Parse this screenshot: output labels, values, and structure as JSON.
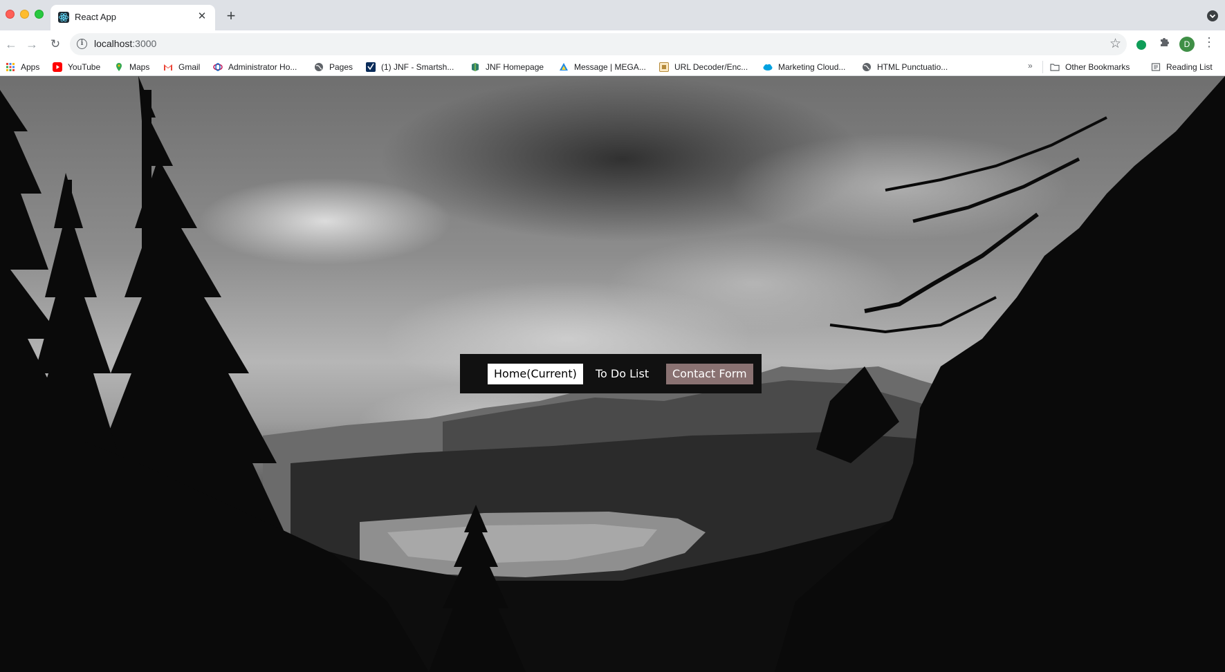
{
  "window": {
    "tab_title": "React App",
    "new_tab_symbol": "+"
  },
  "toolbar": {
    "url_host": "localhost",
    "url_port": ":3000",
    "profile_initial": "D"
  },
  "bookmarks": {
    "items": [
      {
        "label": "Apps",
        "icon": "apps-grid-icon"
      },
      {
        "label": "YouTube",
        "icon": "youtube-icon"
      },
      {
        "label": "Maps",
        "icon": "maps-pin-icon"
      },
      {
        "label": "Gmail",
        "icon": "gmail-icon"
      },
      {
        "label": "Administrator Ho...",
        "icon": "admin-icon"
      },
      {
        "label": "Pages",
        "icon": "globe-icon"
      },
      {
        "label": "(1) JNF - Smartsh...",
        "icon": "smartsheet-icon"
      },
      {
        "label": "JNF Homepage",
        "icon": "jnf-icon"
      },
      {
        "label": "Message | MEGA...",
        "icon": "mega-icon"
      },
      {
        "label": "URL Decoder/Enc...",
        "icon": "decoder-icon"
      },
      {
        "label": "Marketing Cloud...",
        "icon": "salesforce-cloud-icon"
      },
      {
        "label": "HTML Punctuatio...",
        "icon": "globe-icon"
      }
    ],
    "overflow": "»",
    "other_bookmarks": "Other Bookmarks",
    "reading_list": "Reading List"
  },
  "app": {
    "nav": {
      "home": "Home(Current)",
      "todo": "To Do List",
      "contact": "Contact Form"
    },
    "colors": {
      "navbar_bg": "#111111",
      "active_bg": "#ffffff",
      "contact_bg": "#8a7272"
    }
  }
}
